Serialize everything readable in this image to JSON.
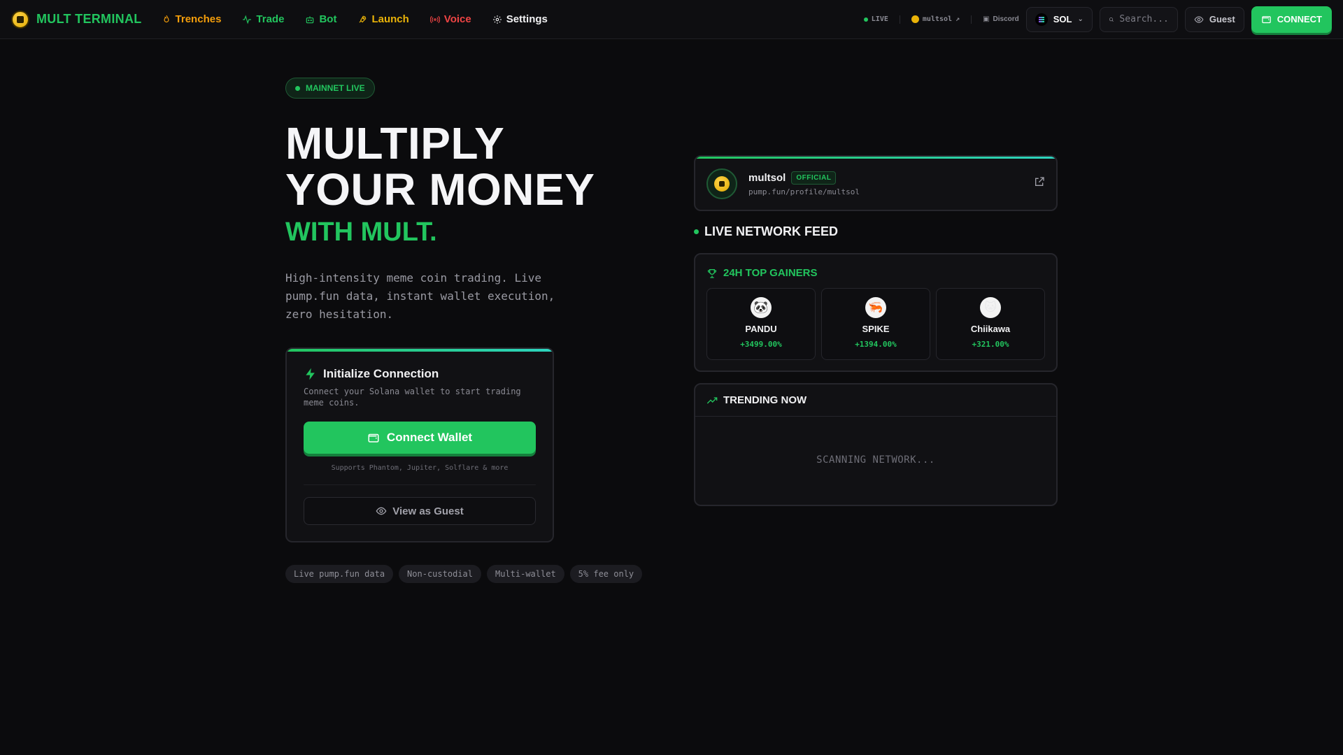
{
  "nav": {
    "brand": "MULT TERMINAL",
    "links": [
      {
        "label": "Trenches",
        "icon": "flame-icon",
        "color": "#f59e0b"
      },
      {
        "label": "Trade",
        "icon": "activity-icon",
        "color": "#22c55e"
      },
      {
        "label": "Bot",
        "icon": "bot-icon",
        "color": "#22c55e"
      },
      {
        "label": "Launch",
        "icon": "rocket-icon",
        "color": "#eab308"
      },
      {
        "label": "Voice",
        "icon": "radio-icon",
        "color": "#ef4444"
      },
      {
        "label": "Settings",
        "icon": "gear-icon",
        "color": "#f1f1f3"
      }
    ],
    "live": "LIVE",
    "handle": "multsol",
    "discord": "Discord",
    "chain": "SOL",
    "search_placeholder": "Search...",
    "guest": "Guest",
    "connect": "CONNECT"
  },
  "hero": {
    "badge": "MAINNET LIVE",
    "title_line1": "MULTIPLY",
    "title_line2": "YOUR MONEY",
    "subtitle": "WITH MULT.",
    "description": "High-intensity meme coin trading. Live pump.fun data, instant wallet execution, zero hesitation."
  },
  "init_card": {
    "title": "Initialize Connection",
    "description": "Connect your Solana wallet to start trading meme coins.",
    "connect_wallet": "Connect Wallet",
    "supports": "Supports Phantom, Jupiter, Solflare & more",
    "view_guest": "View as Guest"
  },
  "tags": [
    "Live pump.fun data",
    "Non-custodial",
    "Multi-wallet",
    "5% fee only"
  ],
  "profile": {
    "name": "multsol",
    "badge": "OFFICIAL",
    "url": "pump.fun/profile/multsol"
  },
  "feed": {
    "title": "LIVE NETWORK FEED",
    "gainers_title": "24H TOP GAINERS",
    "gainers": [
      {
        "name": "PANDU",
        "pct": "+3499.00%",
        "avatar": "🐼"
      },
      {
        "name": "SPIKE",
        "pct": "+1394.00%",
        "avatar": "🦐"
      },
      {
        "name": "Chiikawa",
        "pct": "+321.00%",
        "avatar": "🐱"
      }
    ],
    "trending_title": "TRENDING NOW",
    "scanning": "SCANNING NETWORK..."
  },
  "colors": {
    "accent": "#22c55e",
    "background": "#0b0b0d",
    "card": "#111114"
  }
}
